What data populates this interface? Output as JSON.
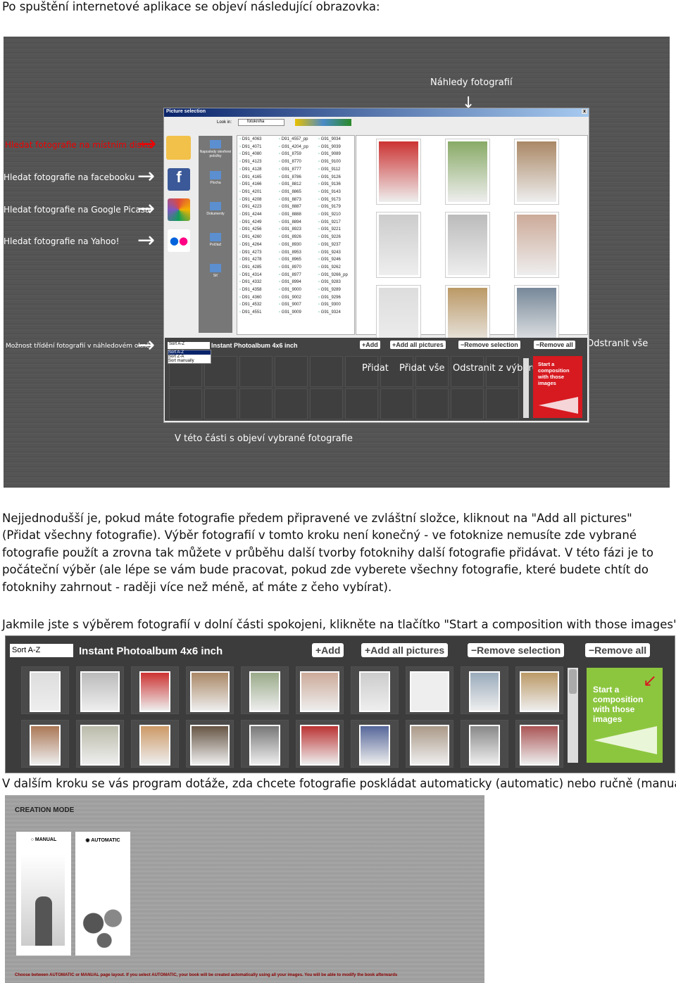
{
  "intro": "Po spuštění internetové aplikace se objeví následující obrazovka:",
  "shot1": {
    "annotations": {
      "previews": "Náhledy fotografií",
      "local": "Hledat fotografie na místním disku",
      "facebook": "Hledat fotografie na facebooku",
      "picasa": "Hledat fotografie na Google Picasa",
      "yahoo": "Hledat fotografie na Yahoo!",
      "sorting": "Možnost třídění fotografií v náhledovém okně",
      "remove_all": "Odstranit vše",
      "add": "Přidat",
      "add_all": "Přidat vše",
      "remove_sel": "Odstranit z výběru",
      "selected_area": "V této části s objeví vybrané fotografie"
    },
    "dialog": {
      "title": "Picture selection",
      "close": "x",
      "look_in_label": "Look in:",
      "look_in_value": "fotokniha",
      "places": [
        "Naposledy otevřené položky",
        "Plocha",
        "Dokumenty",
        "Počítač",
        "Síť"
      ],
      "files": [
        [
          "D91_4063",
          "D91_4071",
          "D91_4080",
          "D91_4123",
          "D91_4128",
          "D91_4165",
          "D91_4166",
          "D91_4201",
          "D91_4208",
          "D91_4223",
          "D91_4244",
          "D91_4249",
          "D91_4256",
          "D91_4260",
          "D91_4264",
          "D91_4273",
          "D91_4278",
          "D91_4285",
          "D91_4314",
          "D91_4332",
          "D91_4358",
          "D91_4360",
          "D91_4532",
          "D91_4551"
        ],
        [
          "D91_4557_pp",
          "G91_4204_pp",
          "G91_8759",
          "G91_8770",
          "G91_8777",
          "G91_8786",
          "G91_8812",
          "G91_8865",
          "G91_8873",
          "G91_8887",
          "G91_8888",
          "G91_8894",
          "G91_8923",
          "G91_8926",
          "G91_8930",
          "G91_8953",
          "G91_8965",
          "G91_8970",
          "G91_8977",
          "G91_8994",
          "G91_9000",
          "G91_9002",
          "G91_9007",
          "G91_9009"
        ],
        [
          "G91_9034",
          "G91_9039",
          "G91_9089",
          "G91_9100",
          "G91_9112",
          "G91_9126",
          "G91_9136",
          "G91_9143",
          "G91_9173",
          "G91_9179",
          "G91_9210",
          "G91_9217",
          "G91_9221",
          "G91_9226",
          "G91_9237",
          "G91_9243",
          "G91_9246",
          "G91_9262",
          "G91_9266_pp",
          "G91_9283",
          "G91_9289",
          "G91_9296",
          "G91_9300",
          "G91_9324"
        ]
      ],
      "sort_value": "Sort A-Z",
      "sort_options": [
        "Sort A-Z",
        "Sort Z-A",
        "Sort manually"
      ],
      "album": "Instant Photoalbum 4x6 inch",
      "add": "+Add",
      "add_all": "+Add all pictures",
      "remove_sel": "−Remove selection",
      "remove_all": "−Remove all",
      "start": "Start a composition with those images"
    }
  },
  "para1": "Nejjednodušší je, pokud máte fotografie předem připravené ve zvláštní složce, kliknout na \"Add all pictures\" (Přidat všechny fotografie). Výběr fotografií v tomto kroku není konečný - ve fotoknize nemusíte zde vybrané fotografie použít a zrovna tak můžete v průběhu další tvorby fotoknihy další fotografie přidávat. V této fázi je to počáteční výběr (ale lépe se vám bude pracovat, pokud zde vyberete všechny fotografie, které budete chtít do fotoknihy zahrnout - raději více než méně, ať máte z čeho vybírat).",
  "para2": "Jakmile jste s výběrem fotografií v dolní části spokojeni, klikněte na tlačítko \"Start a composition with those images\".",
  "shot2": {
    "sort_value": "Sort A-Z",
    "album": "Instant Photoalbum 4x6 inch",
    "add": "+Add",
    "add_all": "+Add all pictures",
    "remove_sel": "−Remove selection",
    "remove_all": "−Remove all",
    "start": "Start a composition with those images",
    "start_color": "#8cc63f"
  },
  "para3": "V dalším kroku se vás program dotáže, zda chcete fotografie poskládat automaticky (automatic) nebo ručně (manual)",
  "shot3": {
    "heading": "CREATION MODE",
    "manual": "MANUAL",
    "automatic": "AUTOMATIC",
    "selected": "AUTOMATIC",
    "hint": "Choose between AUTOMATIC or MANUAL page layout. If you select AUTOMATIC, your book will be created automatically using all your images. You will be able to modify the book afterwards"
  }
}
